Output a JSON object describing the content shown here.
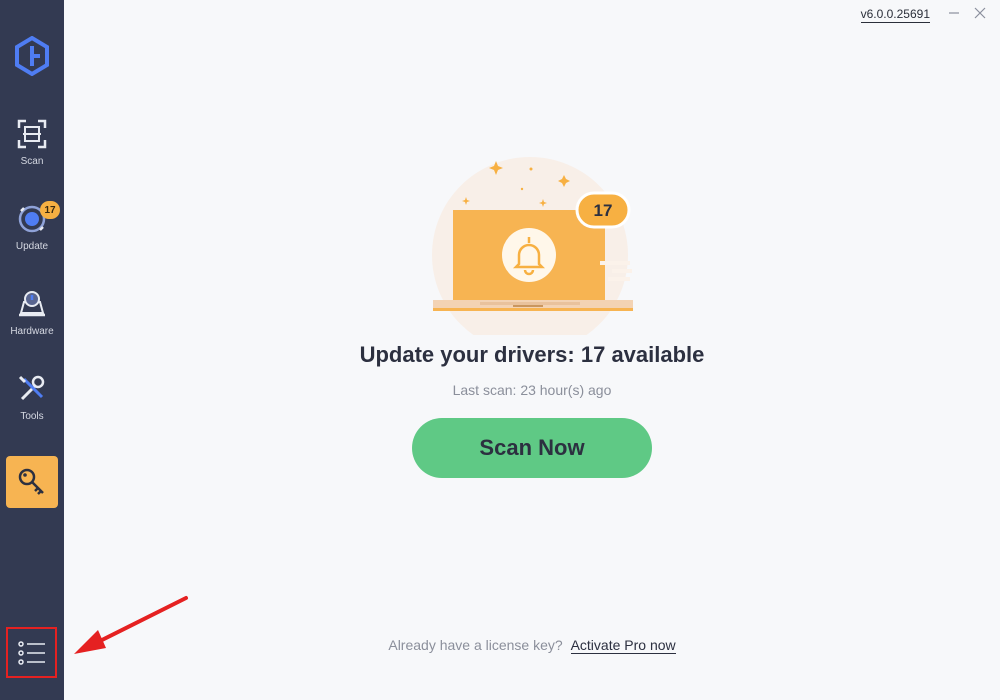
{
  "window": {
    "version": "v6.0.0.25691"
  },
  "sidebar": {
    "items": [
      {
        "label": "Scan"
      },
      {
        "label": "Update",
        "badge": "17"
      },
      {
        "label": "Hardware"
      },
      {
        "label": "Tools"
      }
    ]
  },
  "main": {
    "illustration_badge": "17",
    "headline": "Update your drivers: 17 available",
    "last_scan": "Last scan: 23 hour(s) ago",
    "scan_button": "Scan Now",
    "license_prompt": "Already have a license key?",
    "license_link": "Activate Pro now"
  },
  "colors": {
    "sidebar_bg": "#333a52",
    "accent_orange": "#f7b042",
    "scan_green": "#5fc985",
    "annotation_red": "#e52121"
  }
}
